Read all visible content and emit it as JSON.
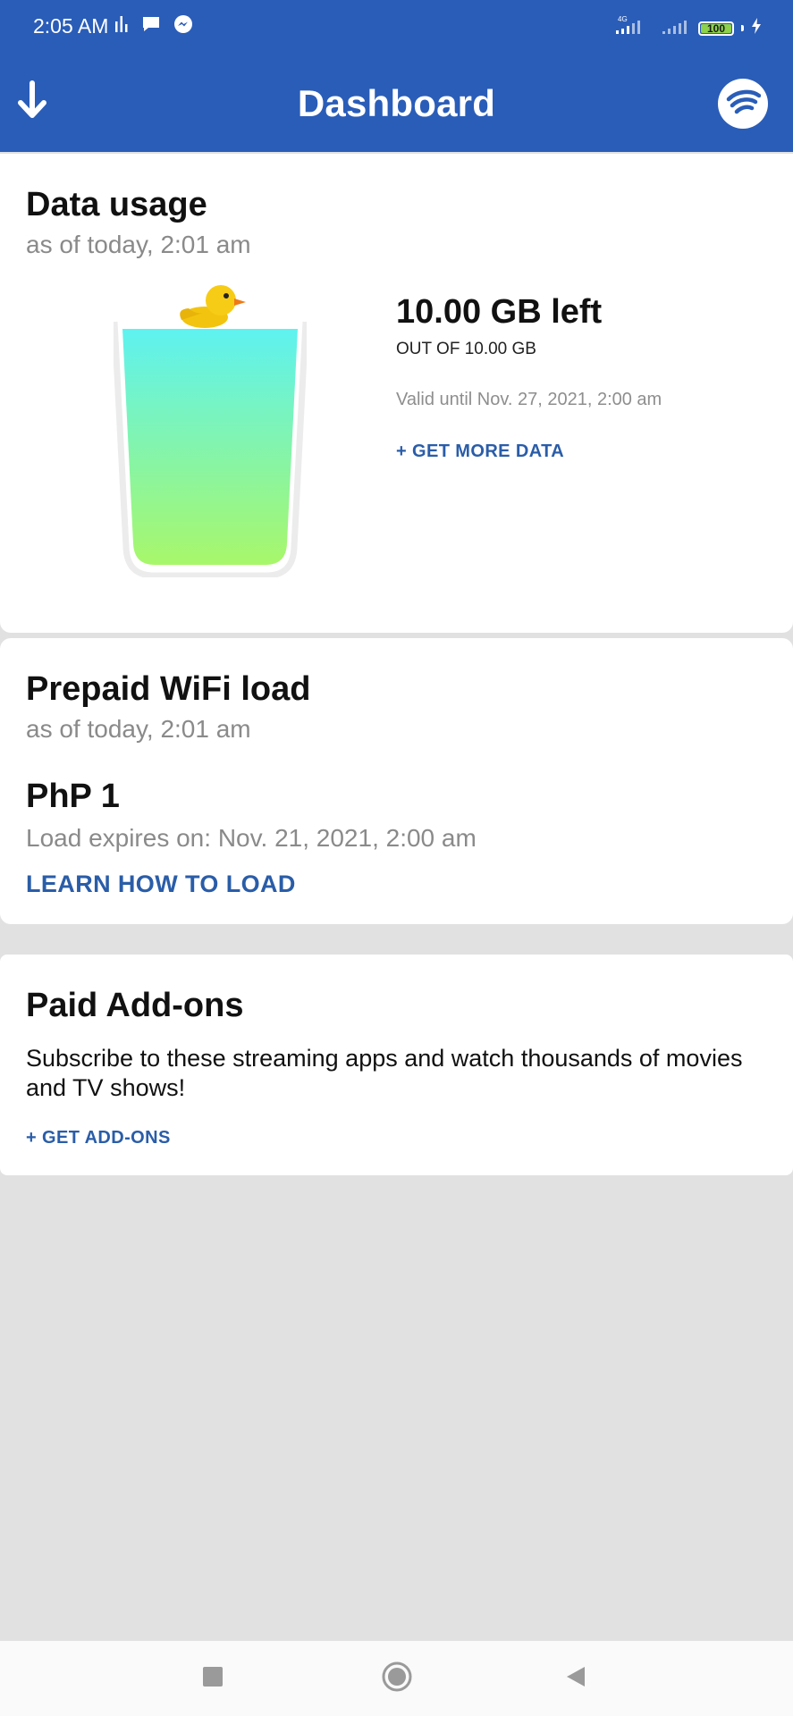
{
  "status_bar": {
    "time": "2:05 AM",
    "network_type": "4G",
    "battery": "100"
  },
  "header": {
    "title": "Dashboard"
  },
  "data_usage": {
    "title": "Data usage",
    "as_of": "as of today, 2:01 am",
    "remaining": "10.00 GB left",
    "total": "OUT OF 10.00 GB",
    "valid_until": "Valid until Nov. 27, 2021, 2:00 am",
    "get_more_label": "+ GET MORE DATA",
    "fill_fraction": 1.0
  },
  "prepaid_load": {
    "title": "Prepaid WiFi load",
    "as_of": "as of today, 2:01 am",
    "amount": "PhP 1",
    "expires": "Load expires on: Nov. 21, 2021, 2:00 am",
    "learn_label": "LEARN HOW TO LOAD"
  },
  "paid_addons": {
    "title": "Paid Add-ons",
    "description": "Subscribe to these streaming apps and watch thousands of movies and TV shows!",
    "get_label": "+ GET ADD-ONS"
  },
  "colors": {
    "brand_blue": "#2a5db8",
    "link_blue": "#2a5da8",
    "glass_top": "#5ef2f0",
    "glass_bottom": "#a8f76a"
  },
  "icons": {
    "header_left": "download-arrow-icon",
    "header_right": "wifi-logo-icon",
    "nav_recents": "square-icon",
    "nav_home": "circle-icon",
    "nav_back": "triangle-back-icon"
  }
}
